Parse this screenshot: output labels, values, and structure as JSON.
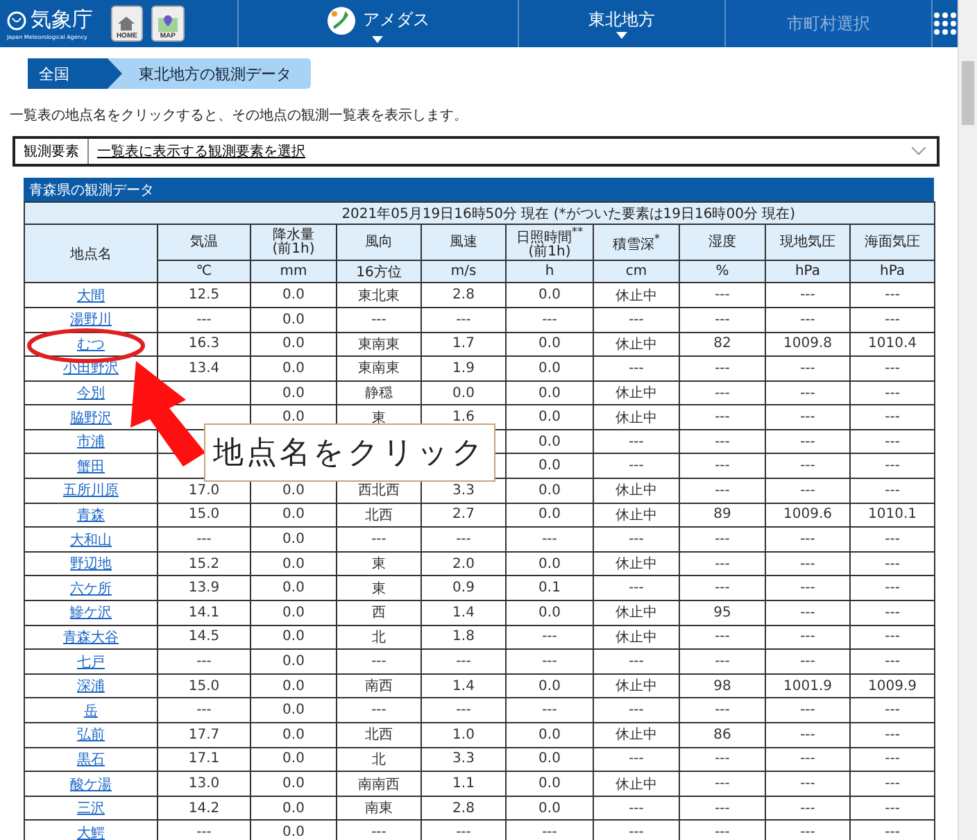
{
  "header": {
    "logo": {
      "title": "気象庁",
      "subtitle": "Japan Meteorological Agency"
    },
    "buttons": [
      {
        "label": "HOME",
        "kind": "home"
      },
      {
        "label": "MAP",
        "kind": "map"
      }
    ],
    "nav": [
      {
        "label": "アメダス",
        "dropdown": true,
        "disabled": false,
        "kind": "amedas"
      },
      {
        "label": "東北地方",
        "dropdown": true,
        "disabled": false,
        "kind": "plain"
      },
      {
        "label": "市町村選択",
        "dropdown": false,
        "disabled": true,
        "kind": "plain"
      }
    ]
  },
  "breadcrumb": [
    {
      "label": "全国",
      "selected": false
    },
    {
      "label": "東北地方の観測データ",
      "selected": true
    }
  ],
  "description": "一覧表の地点名をクリックすると、その地点の観測一覧表を表示します。",
  "element_select": {
    "label": "観測要素",
    "value": "一覧表に表示する観測要素を選択"
  },
  "table": {
    "title": "青森県の観測データ",
    "timestamp": "2021年05月19日16時50分 現在 (*がついた要素は19日16時00分 現在)",
    "station_header": "地点名",
    "columns": [
      {
        "name": "気温",
        "unit": "℃"
      },
      {
        "name": "降水量",
        "note": "(前1h)",
        "unit": "mm"
      },
      {
        "name": "風向",
        "unit": "16方位"
      },
      {
        "name": "風速",
        "unit": "m/s"
      },
      {
        "name": "日照時間$^{**}$",
        "note": "(前1h)",
        "unit": "h"
      },
      {
        "name": "積雪深$^{*}$",
        "unit": "cm"
      },
      {
        "name": "湿度",
        "unit": "%"
      },
      {
        "name": "現地気圧",
        "unit": "hPa"
      },
      {
        "name": "海面気圧",
        "unit": "hPa"
      }
    ],
    "rows": [
      {
        "station": "大間",
        "values": {
          "temp": "12.5",
          "precip": "0.0",
          "wind_dir": "東北東",
          "wind_speed": "2.8",
          "sunshine": "0.0",
          "snow": "休止中",
          "humidity": "---",
          "pressure": "---",
          "sea_pressure": "---"
        }
      },
      {
        "station": "湯野川",
        "values": {
          "temp": "---",
          "precip": "0.0",
          "wind_dir": "---",
          "wind_speed": "---",
          "sunshine": "---",
          "snow": "---",
          "humidity": "---",
          "pressure": "---",
          "sea_pressure": "---"
        }
      },
      {
        "station": "むつ",
        "values": {
          "temp": "16.3",
          "precip": "0.0",
          "wind_dir": "東南東",
          "wind_speed": "1.7",
          "sunshine": "0.0",
          "snow": "休止中",
          "humidity": "82",
          "pressure": "1009.8",
          "sea_pressure": "1010.4"
        }
      },
      {
        "station": "小田野沢",
        "values": {
          "temp": "13.4",
          "precip": "0.0",
          "wind_dir": "東南東",
          "wind_speed": "1.9",
          "sunshine": "0.0",
          "snow": "---",
          "humidity": "---",
          "pressure": "---",
          "sea_pressure": "---"
        }
      },
      {
        "station": "今別",
        "values": {
          "precip": "0.0",
          "wind_dir": "静穏",
          "wind_speed": "0.0",
          "sunshine": "0.0",
          "snow": "休止中",
          "humidity": "---",
          "pressure": "---",
          "sea_pressure": "---"
        }
      },
      {
        "station": "脇野沢",
        "values": {
          "precip": "0.0",
          "wind_dir": "東",
          "wind_speed": "1.6",
          "sunshine": "0.0",
          "snow": "休止中",
          "humidity": "---",
          "pressure": "---",
          "sea_pressure": "---"
        }
      },
      {
        "station": "市浦",
        "values": {
          "sunshine": "0.0",
          "snow": "---",
          "humidity": "---",
          "pressure": "---",
          "sea_pressure": "---"
        }
      },
      {
        "station": "蟹田",
        "values": {
          "sunshine": "0.0",
          "snow": "---",
          "humidity": "---",
          "pressure": "---",
          "sea_pressure": "---"
        }
      },
      {
        "station": "五所川原",
        "values": {
          "temp": "17.0",
          "precip": "0.0",
          "wind_dir": "西北西",
          "wind_speed": "3.3",
          "sunshine": "0.0",
          "snow": "休止中",
          "humidity": "---",
          "pressure": "---",
          "sea_pressure": "---"
        }
      },
      {
        "station": "青森",
        "values": {
          "temp": "15.0",
          "precip": "0.0",
          "wind_dir": "北西",
          "wind_speed": "2.7",
          "sunshine": "0.0",
          "snow": "休止中",
          "humidity": "89",
          "pressure": "1009.6",
          "sea_pressure": "1010.1"
        }
      },
      {
        "station": "大和山",
        "values": {
          "temp": "---",
          "precip": "0.0",
          "wind_dir": "---",
          "wind_speed": "---",
          "sunshine": "---",
          "snow": "---",
          "humidity": "---",
          "pressure": "---",
          "sea_pressure": "---"
        }
      },
      {
        "station": "野辺地",
        "values": {
          "temp": "15.2",
          "precip": "0.0",
          "wind_dir": "東",
          "wind_speed": "2.0",
          "sunshine": "0.0",
          "snow": "休止中",
          "humidity": "---",
          "pressure": "---",
          "sea_pressure": "---"
        }
      },
      {
        "station": "六ケ所",
        "values": {
          "temp": "13.9",
          "precip": "0.0",
          "wind_dir": "東",
          "wind_speed": "0.9",
          "sunshine": "0.1",
          "snow": "---",
          "humidity": "---",
          "pressure": "---",
          "sea_pressure": "---"
        }
      },
      {
        "station": "鰺ケ沢",
        "values": {
          "temp": "14.1",
          "precip": "0.0",
          "wind_dir": "西",
          "wind_speed": "1.4",
          "sunshine": "0.0",
          "snow": "休止中",
          "humidity": "95",
          "pressure": "---",
          "sea_pressure": "---"
        }
      },
      {
        "station": "青森大谷",
        "values": {
          "temp": "14.5",
          "precip": "0.0",
          "wind_dir": "北",
          "wind_speed": "1.8",
          "sunshine": "---",
          "snow": "休止中",
          "humidity": "---",
          "pressure": "---",
          "sea_pressure": "---"
        }
      },
      {
        "station": "七戸",
        "values": {
          "temp": "---",
          "precip": "0.0",
          "wind_dir": "---",
          "wind_speed": "---",
          "sunshine": "---",
          "snow": "---",
          "humidity": "---",
          "pressure": "---",
          "sea_pressure": "---"
        }
      },
      {
        "station": "深浦",
        "values": {
          "temp": "15.0",
          "precip": "0.0",
          "wind_dir": "南西",
          "wind_speed": "1.4",
          "sunshine": "0.0",
          "snow": "休止中",
          "humidity": "98",
          "pressure": "1001.9",
          "sea_pressure": "1009.9"
        }
      },
      {
        "station": "岳",
        "values": {
          "temp": "---",
          "precip": "0.0",
          "wind_dir": "---",
          "wind_speed": "---",
          "sunshine": "---",
          "snow": "---",
          "humidity": "---",
          "pressure": "---",
          "sea_pressure": "---"
        }
      },
      {
        "station": "弘前",
        "values": {
          "temp": "17.7",
          "precip": "0.0",
          "wind_dir": "北西",
          "wind_speed": "1.0",
          "sunshine": "0.0",
          "snow": "休止中",
          "humidity": "86",
          "pressure": "---",
          "sea_pressure": "---"
        }
      },
      {
        "station": "黒石",
        "values": {
          "temp": "17.1",
          "precip": "0.0",
          "wind_dir": "北",
          "wind_speed": "3.3",
          "sunshine": "0.0",
          "snow": "---",
          "humidity": "---",
          "pressure": "---",
          "sea_pressure": "---"
        }
      },
      {
        "station": "酸ケ湯",
        "values": {
          "temp": "13.0",
          "precip": "0.0",
          "wind_dir": "南南西",
          "wind_speed": "1.1",
          "sunshine": "0.0",
          "snow": "休止中",
          "humidity": "---",
          "pressure": "---",
          "sea_pressure": "---"
        }
      },
      {
        "station": "三沢",
        "values": {
          "temp": "14.2",
          "precip": "0.0",
          "wind_dir": "南東",
          "wind_speed": "2.8",
          "sunshine": "0.0",
          "snow": "---",
          "humidity": "---",
          "pressure": "---",
          "sea_pressure": "---"
        }
      },
      {
        "station": "大鰐",
        "values": {
          "temp": "---",
          "precip": "0.0",
          "wind_dir": "---",
          "wind_speed": "---",
          "sunshine": "---",
          "snow": "---",
          "humidity": "---",
          "pressure": "---",
          "sea_pressure": "---"
        }
      }
    ]
  },
  "annotation": {
    "callout": "地点名をクリック"
  }
}
